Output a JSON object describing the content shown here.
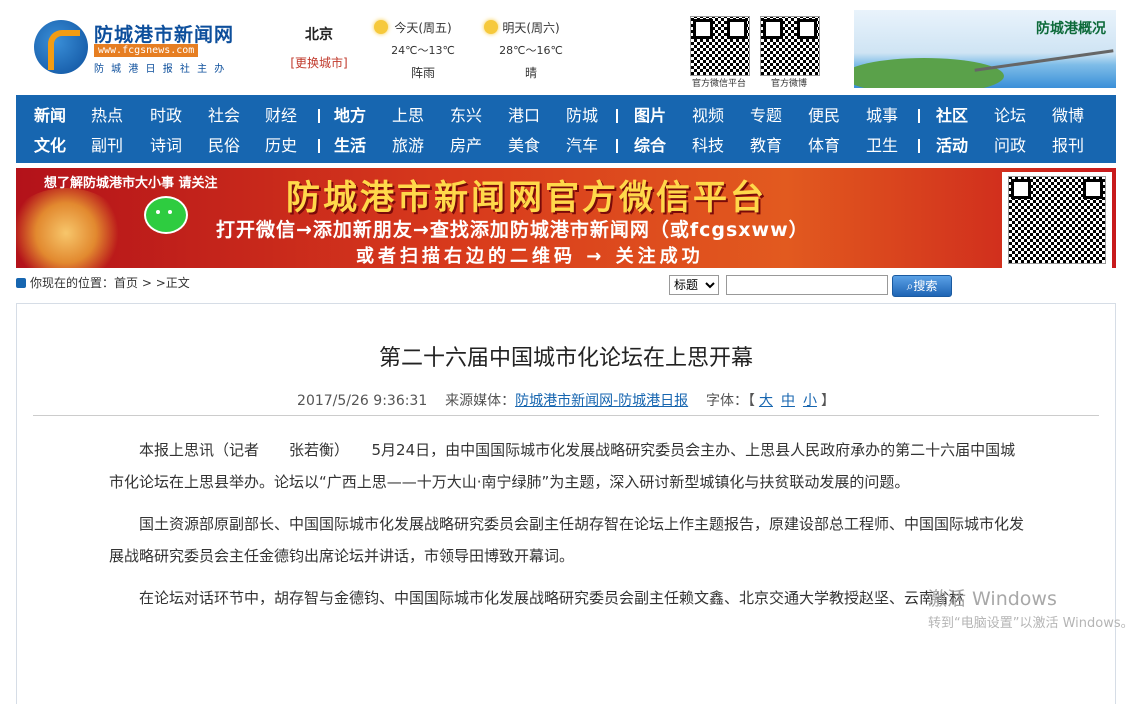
{
  "header": {
    "logo_name": "防城港市新闻网",
    "logo_url": "www.fcgsnews.com",
    "logo_sub": "防 城 港 日 报 社 主 办",
    "city": "北京",
    "change_city": "[更换城市]",
    "weather": [
      {
        "day": "今天(周五)",
        "temp": "24℃～13℃",
        "cond": "阵雨"
      },
      {
        "day": "明天(周六)",
        "temp": "28℃～16℃",
        "cond": "晴"
      }
    ],
    "qr1_label": "官方微信平台",
    "qr2_label": "官方微博",
    "promo_title": "防城港概况"
  },
  "nav": {
    "row1": [
      {
        "label": "新闻",
        "bold": true
      },
      {
        "label": "热点"
      },
      {
        "label": "时政"
      },
      {
        "label": "社会"
      },
      {
        "label": "财经"
      },
      {
        "label": "地方",
        "bold": true
      },
      {
        "label": "上思"
      },
      {
        "label": "东兴"
      },
      {
        "label": "港口"
      },
      {
        "label": "防城"
      },
      {
        "label": "图片",
        "bold": true
      },
      {
        "label": "视频"
      },
      {
        "label": "专题"
      },
      {
        "label": "便民"
      },
      {
        "label": "城事"
      },
      {
        "label": "社区",
        "bold": true
      },
      {
        "label": "论坛"
      },
      {
        "label": "微博"
      }
    ],
    "row2": [
      {
        "label": "文化",
        "bold": true
      },
      {
        "label": "副刊"
      },
      {
        "label": "诗词"
      },
      {
        "label": "民俗"
      },
      {
        "label": "历史"
      },
      {
        "label": "生活",
        "bold": true
      },
      {
        "label": "旅游"
      },
      {
        "label": "房产"
      },
      {
        "label": "美食"
      },
      {
        "label": "汽车"
      },
      {
        "label": "综合",
        "bold": true
      },
      {
        "label": "科技"
      },
      {
        "label": "教育"
      },
      {
        "label": "体育"
      },
      {
        "label": "卫生"
      },
      {
        "label": "活动",
        "bold": true
      },
      {
        "label": "问政"
      },
      {
        "label": "报刊"
      }
    ]
  },
  "banner": {
    "top": "想了解防城港市大小事 请关注",
    "title": "防城港市新闻网官方微信平台",
    "line1": "打开微信→添加新朋友→查找添加防城港市新闻网（或fcgsxww）",
    "line2": "或者扫描右边的二维码 → 关注成功"
  },
  "breadcrumb": {
    "prefix": "你现在的位置：",
    "home": "首页",
    "sep": " > ",
    "current": ">正文"
  },
  "search": {
    "select_value": "标题",
    "button": "搜索",
    "input_value": ""
  },
  "article": {
    "title": "第二十六届中国城市化论坛在上思开幕",
    "date": "2017/5/26 9:36:31",
    "source_label": "来源媒体：",
    "source": "防城港市新闻网-防城港日报",
    "font_label": "字体：",
    "font_sizes": [
      "大",
      "中",
      "小"
    ],
    "paragraphs": [
      "本报上思讯（记者　　张若衡）　　5月24日，由中国国际城市化发展战略研究委员会主办、上思县人民政府承办的第二十六届中国城市化论坛在上思县举办。论坛以“广西上思——十万大山·南宁绿肺”为主题，深入研讨新型城镇化与扶贫联动发展的问题。",
      "国土资源部原副部长、中国国际城市化发展战略研究委员会副主任胡存智在论坛上作主题报告，原建设部总工程师、中国国际城市化发展战略研究委员会主任金德钧出席论坛并讲话，市领导田博致开幕词。",
      "在论坛对话环节中，胡存智与金德钧、中国国际城市化发展战略研究委员会副主任赖文鑫、北京交通大学教授赵坚、云南省林"
    ]
  },
  "watermark": {
    "line1": "激活 Windows",
    "line2": "转到“电脑设置”以激活 Windows。"
  }
}
